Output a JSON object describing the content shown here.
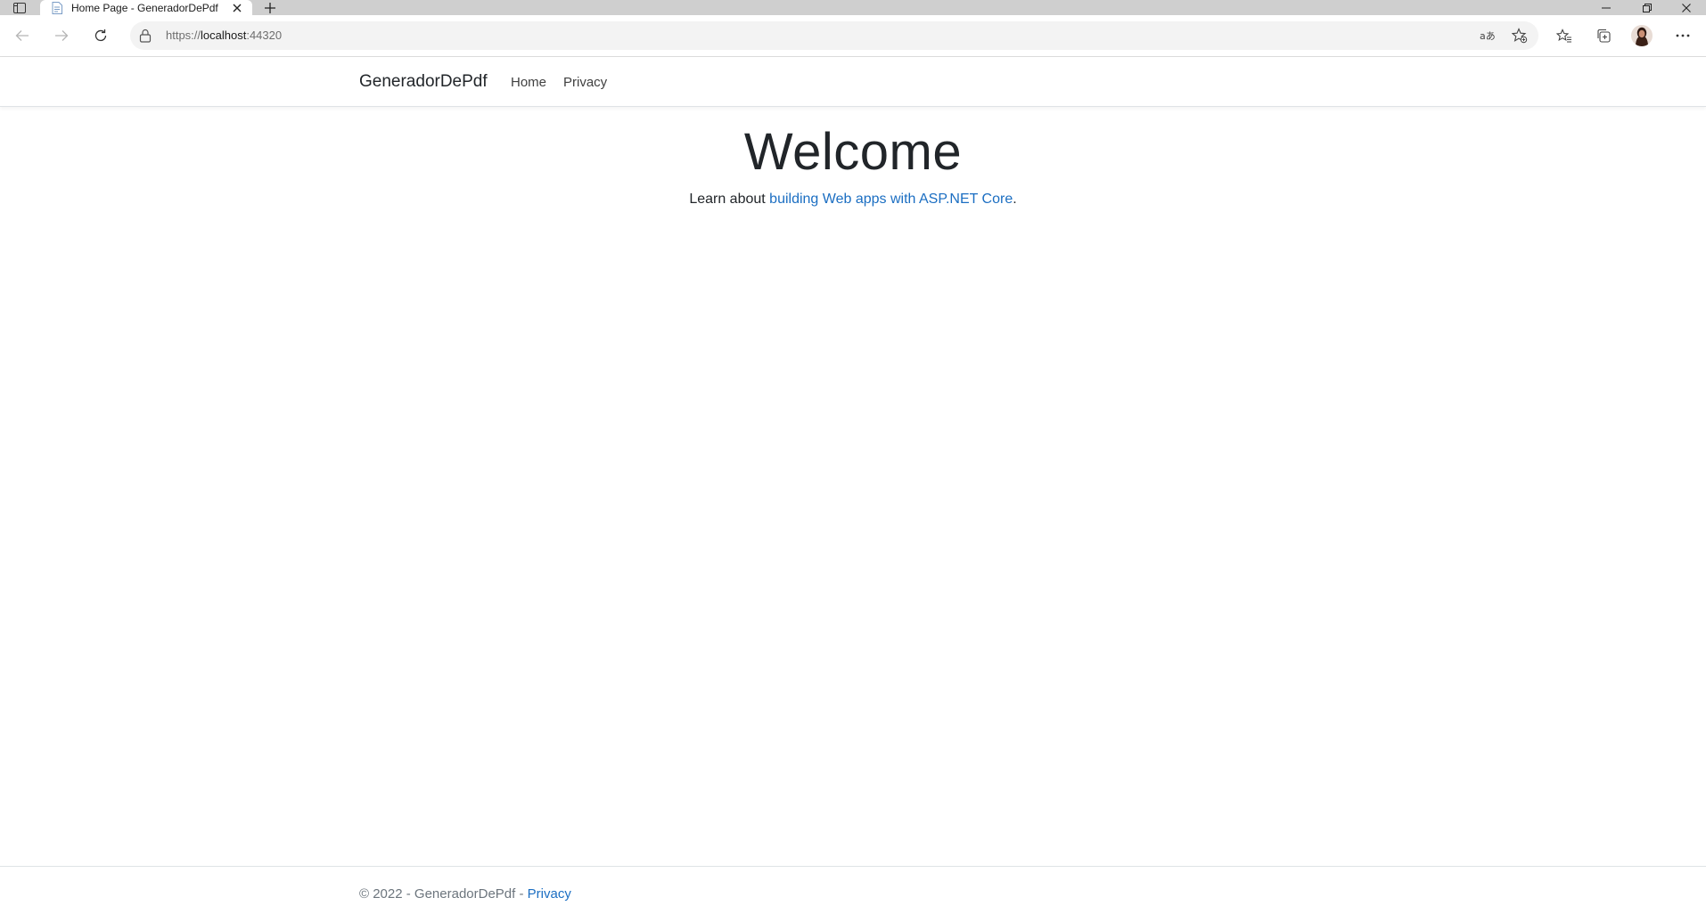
{
  "browser": {
    "tab_title": "Home Page - GeneradorDePdf",
    "url_scheme": "https://",
    "url_host": "localhost",
    "url_port": ":44320",
    "icons": [
      "tab-actions-icon",
      "page-favicon-icon",
      "close-icon",
      "plus-icon",
      "minimize-icon",
      "restore-icon",
      "window-close-icon",
      "back-arrow-icon",
      "forward-arrow-icon",
      "refresh-icon",
      "lock-icon",
      "read-aloud-icon",
      "add-favorite-icon",
      "favorites-icon",
      "collections-icon",
      "profile-avatar",
      "more-options-icon"
    ]
  },
  "navbar": {
    "brand": "GeneradorDePdf",
    "links": [
      {
        "label": "Home"
      },
      {
        "label": "Privacy"
      }
    ]
  },
  "main": {
    "heading": "Welcome",
    "learn_prefix": "Learn about ",
    "learn_link": "building Web apps with ASP.NET Core",
    "learn_suffix": "."
  },
  "footer": {
    "copyright": "© 2022 - GeneradorDePdf - ",
    "privacy_link": "Privacy"
  },
  "colors": {
    "link": "#1b6ec2",
    "text": "#212529",
    "tabstrip": "#cfcfcf",
    "footer_text": "#6c757d"
  }
}
